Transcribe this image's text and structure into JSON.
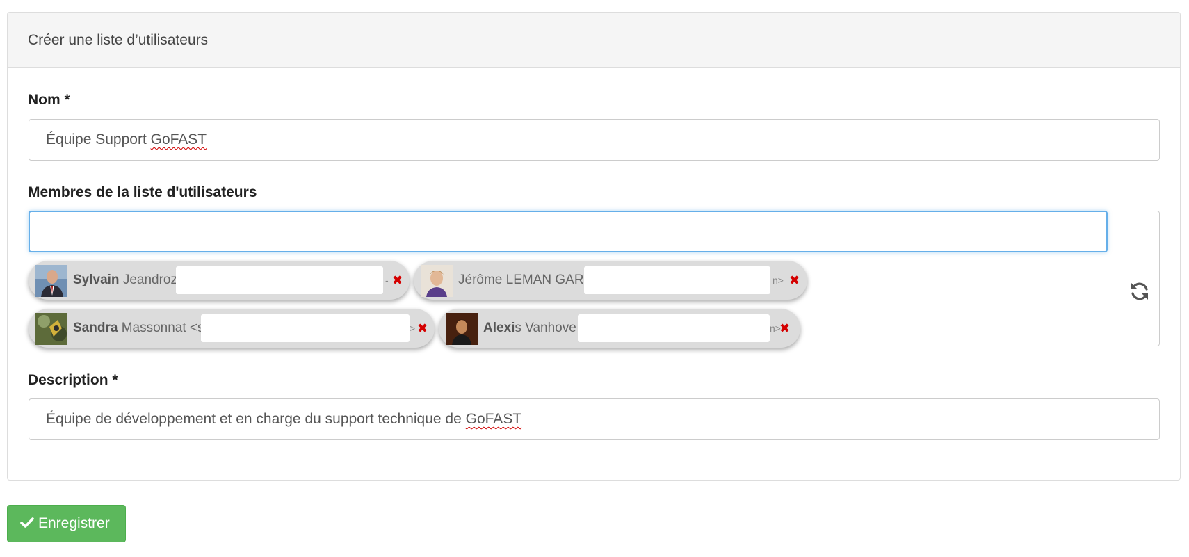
{
  "panel": {
    "title": "Créer une liste d’utilisateurs"
  },
  "form": {
    "name": {
      "label": "Nom *",
      "value_prefix": "Équipe Support ",
      "value_flagged": "GoFAST"
    },
    "members": {
      "label": "Membres de la liste d'utilisateurs",
      "input_value": "",
      "refresh_icon": "refresh-icon",
      "tags": [
        {
          "first": "Sylvain",
          "last": " Jeandroz",
          "tail": "-",
          "remove": "✖"
        },
        {
          "first": "",
          "last": "Jérôme LEMAN GARIN <",
          "tail": "n>",
          "remove": "✖"
        },
        {
          "first": "Sandra",
          "last": " Massonnat <s",
          "tail": ">",
          "remove": "✖"
        },
        {
          "first": "Alexi",
          "last": "s Vanhove <",
          "tail": "n>",
          "remove": "✖"
        }
      ]
    },
    "description": {
      "label": "Description *",
      "value_prefix": "Équipe de développement et en charge du support technique de ",
      "value_flagged": "GoFAST"
    }
  },
  "actions": {
    "save_label": "Enregistrer",
    "save_icon": "check-icon"
  },
  "colors": {
    "primary_button": "#5cb85c",
    "focus_border": "#66afe9",
    "remove_x": "#d40000"
  }
}
